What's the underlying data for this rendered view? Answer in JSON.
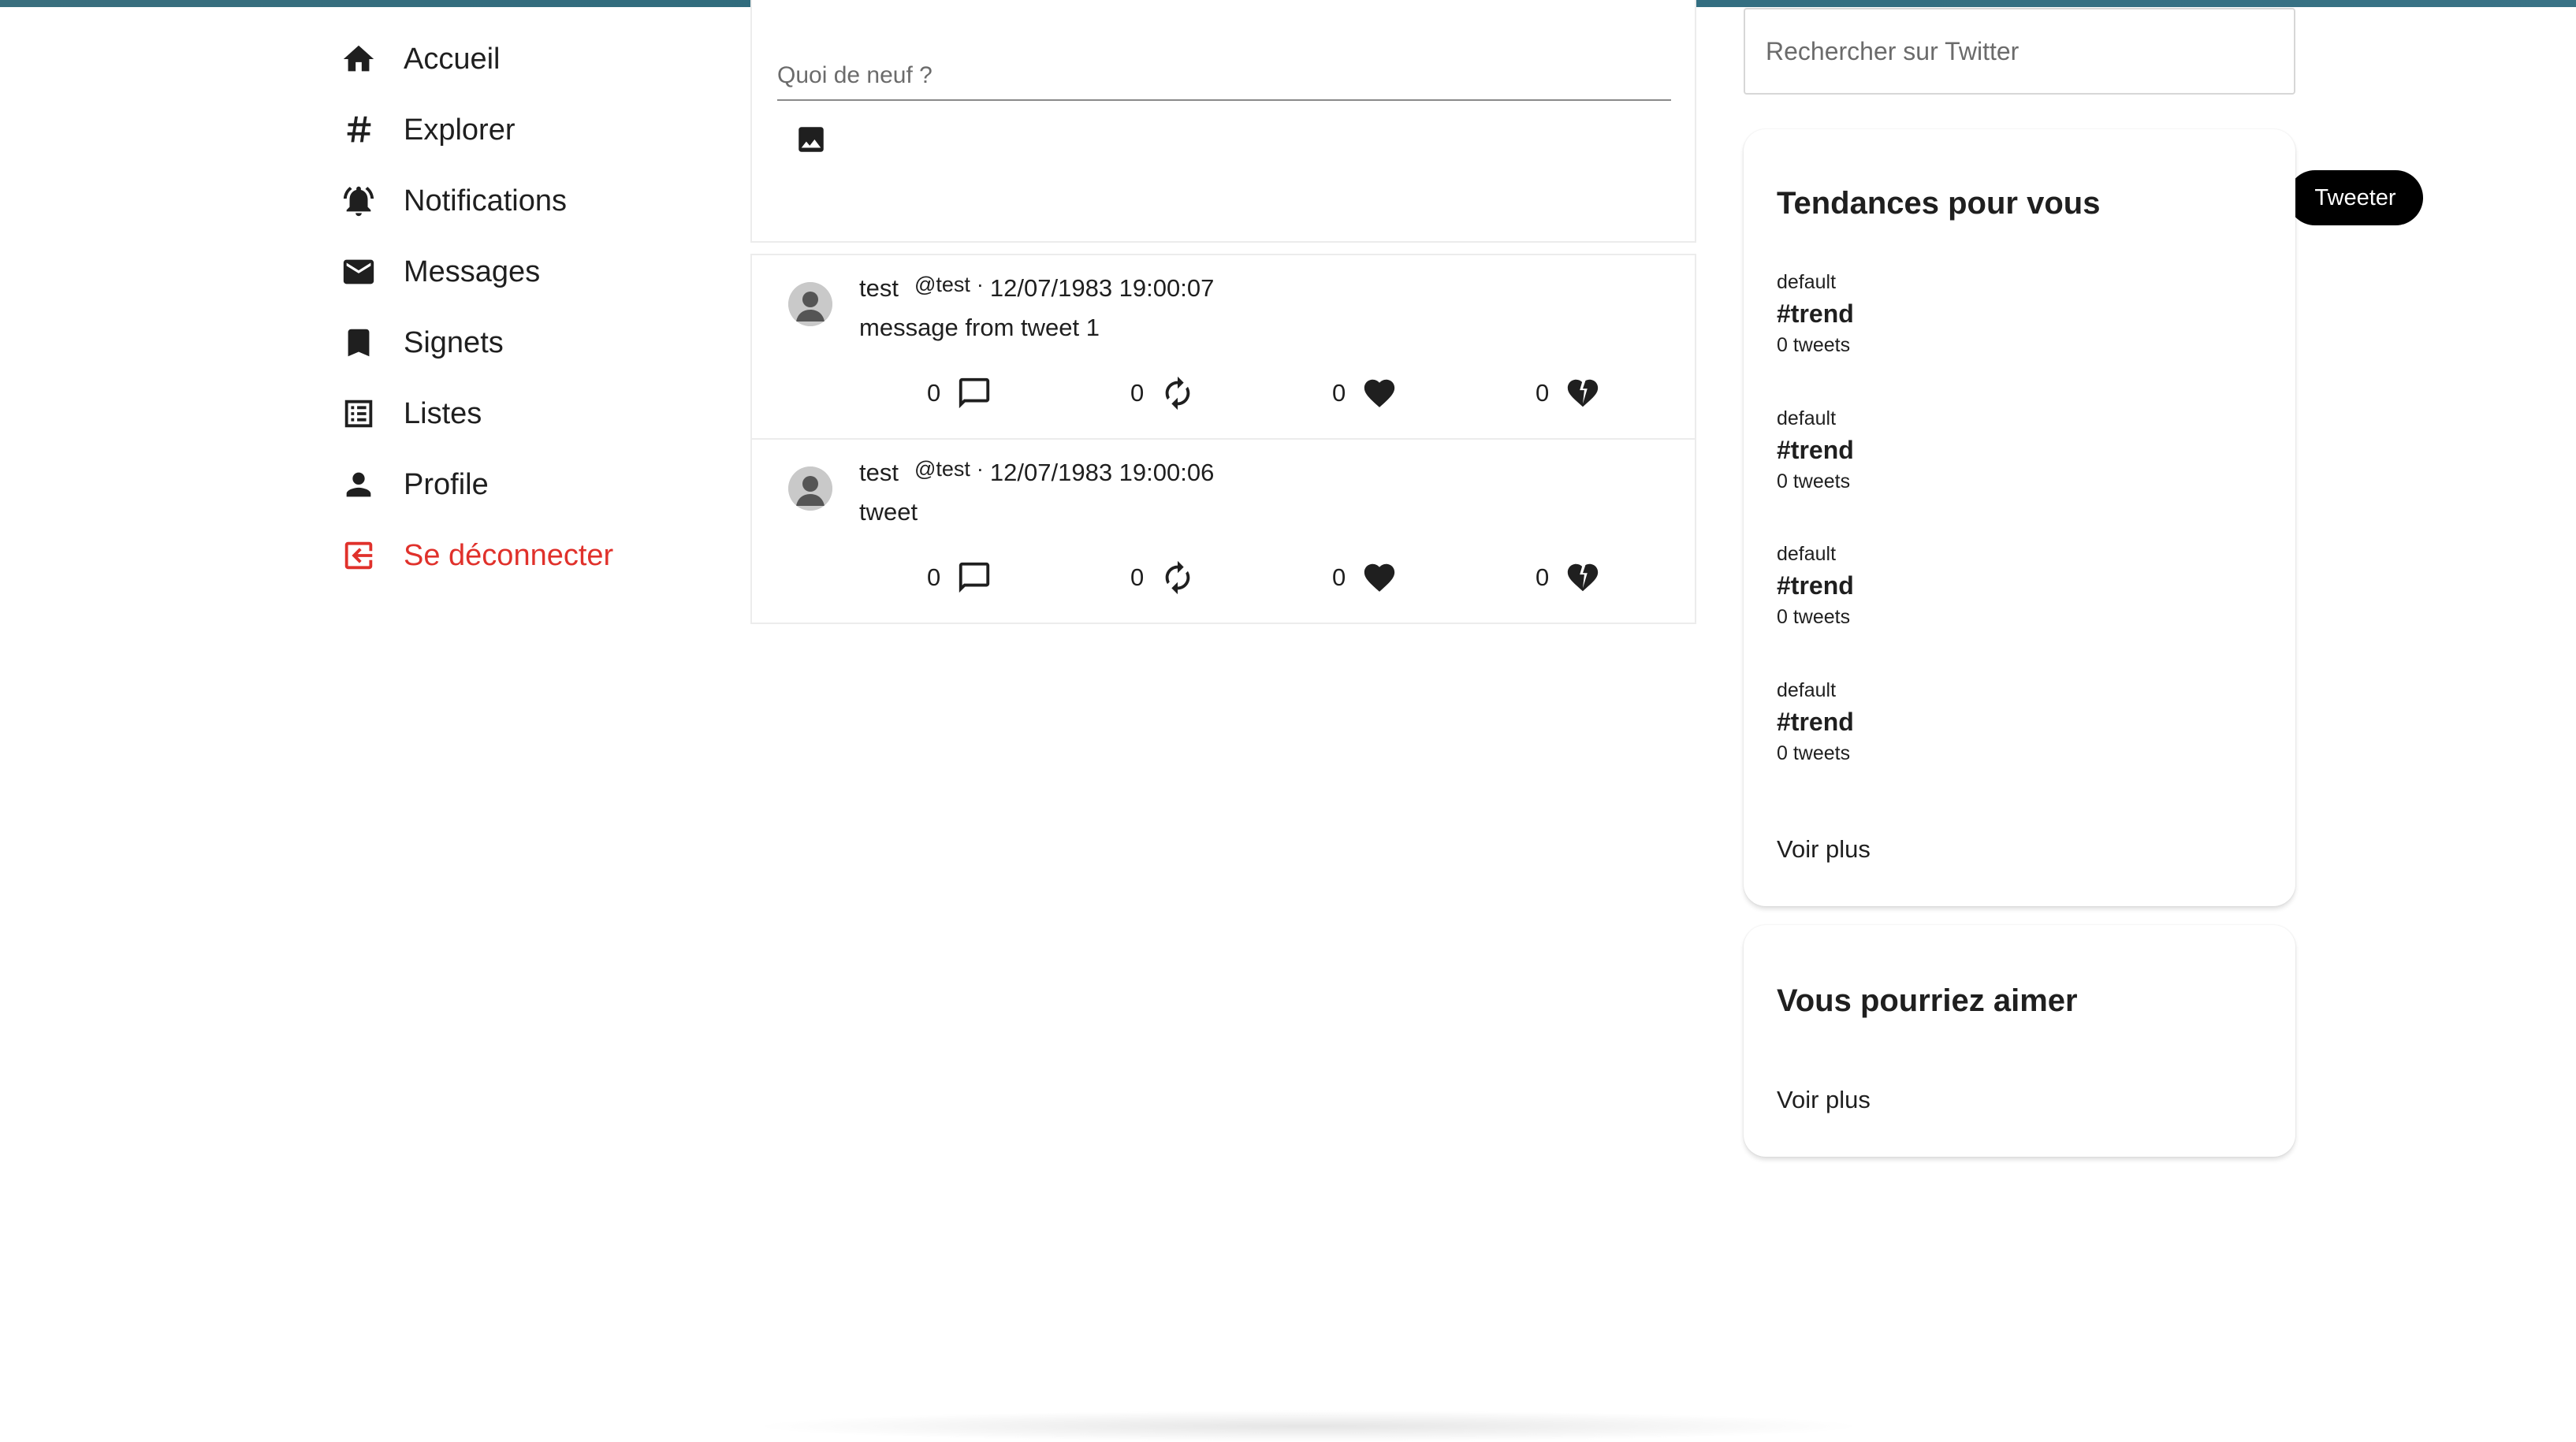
{
  "nav": {
    "items": [
      {
        "label": "Accueil",
        "icon": "home-icon"
      },
      {
        "label": "Explorer",
        "icon": "hashtag-icon"
      },
      {
        "label": "Notifications",
        "icon": "bell-icon"
      },
      {
        "label": "Messages",
        "icon": "mail-icon"
      },
      {
        "label": "Signets",
        "icon": "bookmark-icon"
      },
      {
        "label": "Listes",
        "icon": "list-icon"
      },
      {
        "label": "Profile",
        "icon": "person-icon"
      }
    ],
    "logout": {
      "label": "Se déconnecter",
      "icon": "logout-icon",
      "color": "#e0312b"
    }
  },
  "composer": {
    "placeholder": "Quoi de neuf ?",
    "image_icon": "image-icon",
    "submit_label": "Tweeter"
  },
  "tweets": [
    {
      "name": "test",
      "handle": "@test",
      "separator": "·",
      "date": "12/07/1983 19:00:07",
      "text": "message from tweet 1",
      "replies": "0",
      "retweets": "0",
      "likes": "0",
      "dislikes": "0"
    },
    {
      "name": "test",
      "handle": "@test",
      "separator": "·",
      "date": "12/07/1983 19:00:06",
      "text": "tweet",
      "replies": "0",
      "retweets": "0",
      "likes": "0",
      "dislikes": "0"
    }
  ],
  "search": {
    "placeholder": "Rechercher sur Twitter"
  },
  "trends": {
    "title": "Tendances pour vous",
    "items": [
      {
        "category": "default",
        "tag": "#trend",
        "count": "0 tweets"
      },
      {
        "category": "default",
        "tag": "#trend",
        "count": "0 tweets"
      },
      {
        "category": "default",
        "tag": "#trend",
        "count": "0 tweets"
      },
      {
        "category": "default",
        "tag": "#trend",
        "count": "0 tweets"
      }
    ],
    "see_more": "Voir plus"
  },
  "suggestions": {
    "title": "Vous pourriez aimer",
    "see_more": "Voir plus"
  },
  "colors": {
    "accent_bar": "#2d6a7d",
    "button_bg": "#000000",
    "logout": "#e0312b"
  }
}
